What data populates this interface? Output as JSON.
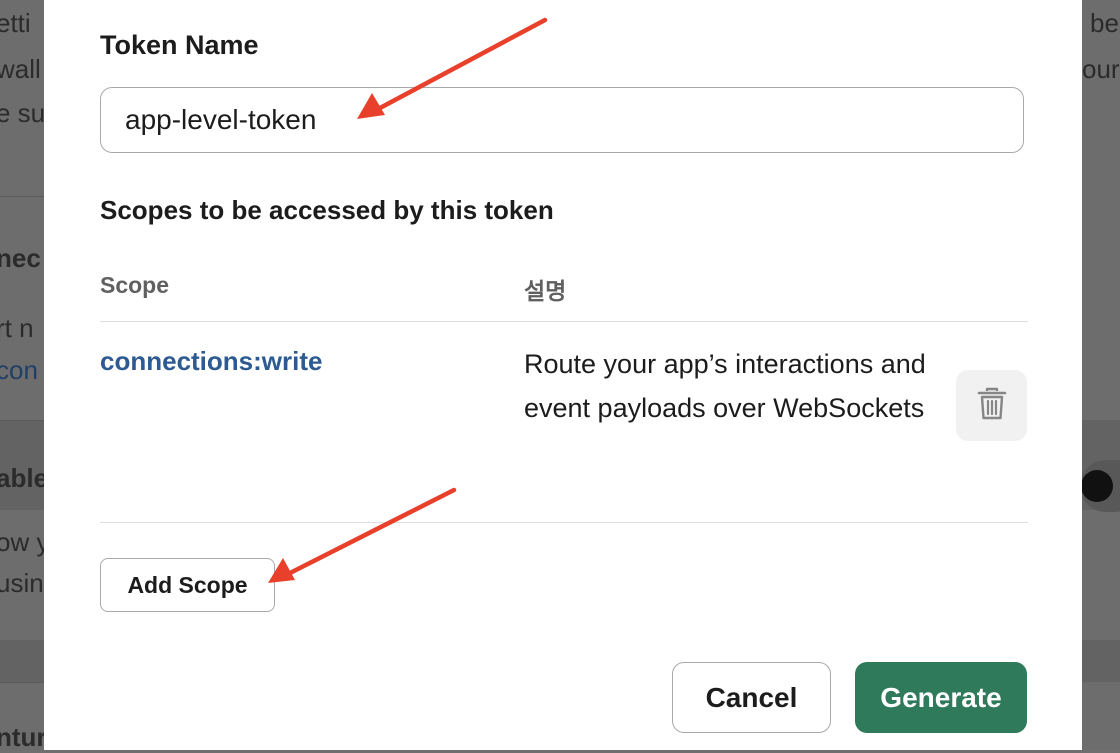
{
  "background": {
    "left_fragments": [
      "etti",
      "wall",
      "e su",
      "nec",
      "rt n",
      "con",
      "able",
      "ow y",
      "usin",
      "ntur"
    ],
    "right_fragments": [
      "be",
      "our"
    ]
  },
  "modal": {
    "token_name_label": "Token Name",
    "token_name_value": "app-level-token",
    "scopes_heading": "Scopes to be accessed by this token",
    "table": {
      "columns": [
        "Scope",
        "설명"
      ],
      "rows": [
        {
          "scope": "connections:write",
          "description": "Route your app’s interactions and event payloads over WebSockets"
        }
      ]
    },
    "add_scope_label": "Add Scope",
    "cancel_label": "Cancel",
    "generate_label": "Generate"
  },
  "icons": {
    "delete_scope": "trash-icon"
  },
  "colors": {
    "primary_button": "#2f7a5a",
    "scope_link": "#2c5a91",
    "annotation_arrow": "#e8402a"
  }
}
